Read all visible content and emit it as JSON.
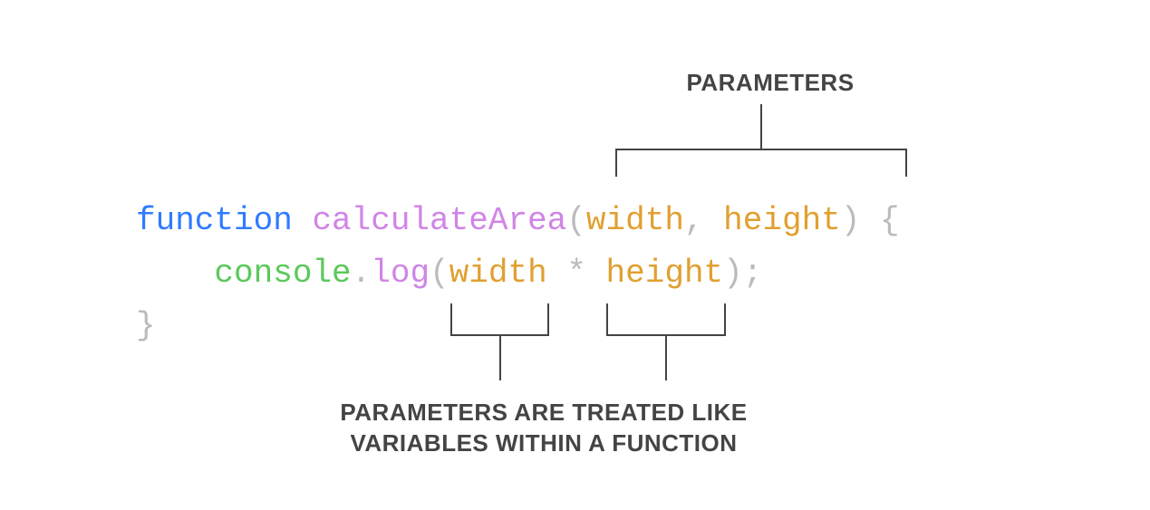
{
  "labels": {
    "top": "PARAMETERS",
    "bottom_line1": "PARAMETERS ARE TREATED LIKE",
    "bottom_line2": "VARIABLES WITHIN A FUNCTION"
  },
  "code": {
    "keyword_function": "function",
    "function_name": "calculateArea",
    "paren_open": "(",
    "param1": "width",
    "comma": ", ",
    "param2": "height",
    "paren_close": ")",
    "brace_open": " {",
    "indent": "    ",
    "console": "console",
    "dot": ".",
    "log": "log",
    "log_paren_open": "(",
    "log_arg1": "width",
    "star": " * ",
    "log_arg2": "height",
    "log_paren_close": ")",
    "semicolon": ";",
    "brace_close": "}"
  },
  "colors": {
    "keyword": "#2f7bff",
    "identifier": "#d085e6",
    "param": "#e0a030",
    "object": "#5bc95b",
    "punct": "#bbbbbb",
    "label": "#444444",
    "bracket": "#444444"
  }
}
